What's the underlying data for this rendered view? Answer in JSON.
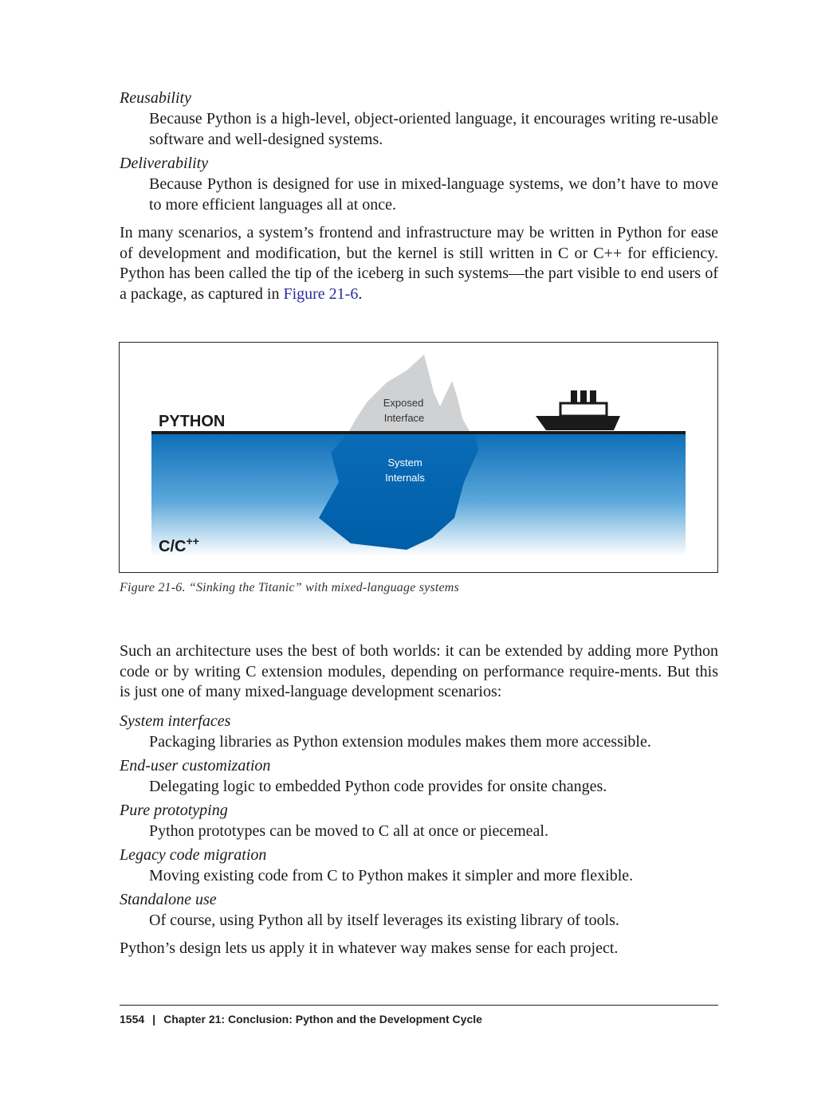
{
  "top_list": [
    {
      "term": "Reusability",
      "definition": "Because Python is a high-level, object-oriented language, it encourages writing re-usable software and well-designed systems."
    },
    {
      "term": "Deliverability",
      "definition": "Because Python is designed for use in mixed-language systems, we don’t have to move to more efficient languages all at once."
    }
  ],
  "para1": {
    "text": "In many scenarios, a system’s frontend and infrastructure may be written in Python for ease of development and modification, but the kernel is still written in C or C++ for efficiency. Python has been called the tip of the iceberg in such systems—the part visible to end users of a package, as captured in ",
    "link": "Figure 21-6",
    "end": "."
  },
  "figure": {
    "python_label": "PYTHON",
    "c_label": "C/C",
    "c_superscript": "++",
    "exposed_line1": "Exposed",
    "exposed_line2": "Interface",
    "internals_line1": "System",
    "internals_line2": "Internals",
    "caption": "Figure 21-6. “Sinking the Titanic” with mixed-language systems",
    "colors": {
      "water_top": "#0d6db8",
      "water_bottom": "#ffffff",
      "iceberg_top": "#cfd0d2",
      "iceberg_bottom": "#0a6bb7",
      "ship": "#1a1a1a"
    }
  },
  "para2": "Such an architecture uses the best of both worlds: it can be extended by adding more Python code or by writing C extension modules, depending on performance require-ments. But this is just one of many mixed-language development scenarios:",
  "bottom_list": [
    {
      "term": "System interfaces",
      "definition": "Packaging libraries as Python extension modules makes them more accessible."
    },
    {
      "term": "End-user customization",
      "definition": "Delegating logic to embedded Python code provides for onsite changes."
    },
    {
      "term": "Pure prototyping",
      "definition": "Python prototypes can be moved to C all at once or piecemeal."
    },
    {
      "term": "Legacy code migration",
      "definition": "Moving existing code from C to Python makes it simpler and more flexible."
    },
    {
      "term": "Standalone use",
      "definition": "Of course, using Python all by itself leverages its existing library of tools."
    }
  ],
  "para3": "Python’s design lets us apply it in whatever way makes sense for each project.",
  "footer": {
    "page_number": "1554",
    "separator": "|",
    "chapter": "Chapter 21:  Conclusion: Python and the Development Cycle"
  }
}
